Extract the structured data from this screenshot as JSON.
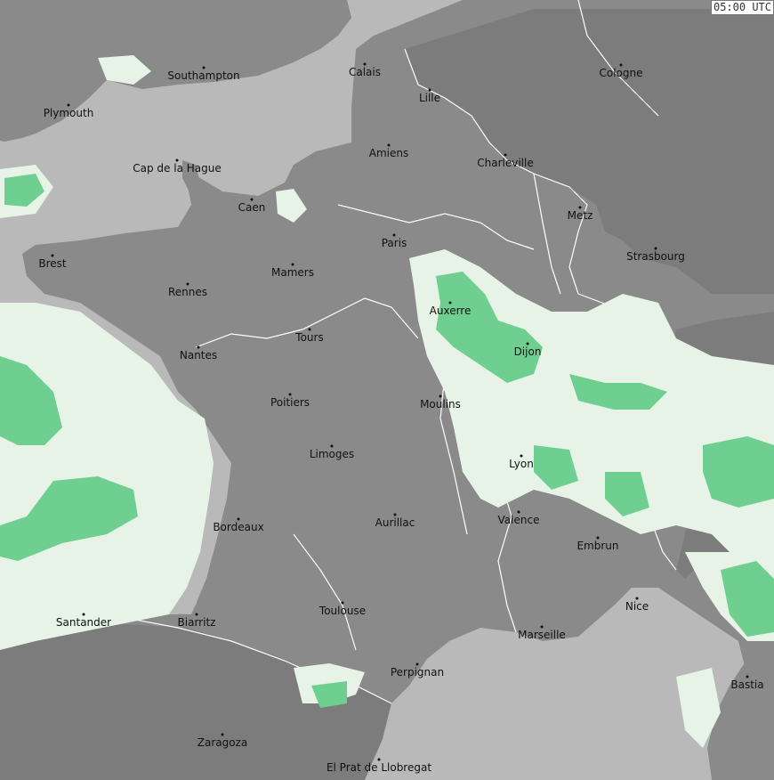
{
  "timestamp": "05:00 UTC",
  "colors": {
    "sea": "#b9b9b9",
    "land": "#8a8a8a",
    "land_dark": "#7c7c7c",
    "border": "#ffffff",
    "precip_light": "#e6f3e6",
    "precip_medium": "#a8dcb6",
    "precip_heavy": "#6fcf91"
  },
  "cities": [
    {
      "name": "Southampton"
    },
    {
      "name": "Calais"
    },
    {
      "name": "Lille"
    },
    {
      "name": "Cologne"
    },
    {
      "name": "Plymouth"
    },
    {
      "name": "Amiens"
    },
    {
      "name": "Charleville"
    },
    {
      "name": "Cap de la Hague"
    },
    {
      "name": "Caen"
    },
    {
      "name": "Metz"
    },
    {
      "name": "Paris"
    },
    {
      "name": "Strasbourg"
    },
    {
      "name": "Brest"
    },
    {
      "name": "Mamers"
    },
    {
      "name": "Rennes"
    },
    {
      "name": "Auxerre"
    },
    {
      "name": "Tours"
    },
    {
      "name": "Dijon"
    },
    {
      "name": "Nantes"
    },
    {
      "name": "Poitiers"
    },
    {
      "name": "Moulins"
    },
    {
      "name": "Limoges"
    },
    {
      "name": "Lyon"
    },
    {
      "name": "Aurillac"
    },
    {
      "name": "Valence"
    },
    {
      "name": "Bordeaux"
    },
    {
      "name": "Embrun"
    },
    {
      "name": "Santander"
    },
    {
      "name": "Biarritz"
    },
    {
      "name": "Toulouse"
    },
    {
      "name": "Nice"
    },
    {
      "name": "Marseille"
    },
    {
      "name": "Perpignan"
    },
    {
      "name": "Bastia"
    },
    {
      "name": "Zaragoza"
    },
    {
      "name": "El Prat de Llobregat"
    }
  ]
}
